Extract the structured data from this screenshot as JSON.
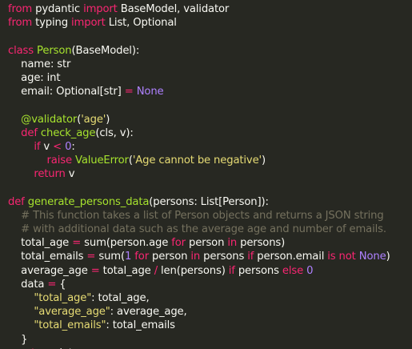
{
  "editor": {
    "lines": [
      [
        [
          "kw",
          "from"
        ],
        [
          "pl",
          " pydantic "
        ],
        [
          "kw",
          "import"
        ],
        [
          "pl",
          " BaseModel, validator"
        ]
      ],
      [
        [
          "kw",
          "from"
        ],
        [
          "pl",
          " typing "
        ],
        [
          "kw",
          "import"
        ],
        [
          "pl",
          " List, Optional"
        ]
      ],
      [],
      [
        [
          "kw",
          "class"
        ],
        [
          "pl",
          " "
        ],
        [
          "cls",
          "Person"
        ],
        [
          "pl",
          "(BaseModel):"
        ]
      ],
      [
        [
          "pl",
          "    name: str"
        ]
      ],
      [
        [
          "pl",
          "    age: int"
        ]
      ],
      [
        [
          "pl",
          "    email: Optional[str] "
        ],
        [
          "op",
          "="
        ],
        [
          "pl",
          " "
        ],
        [
          "con",
          "None"
        ]
      ],
      [],
      [
        [
          "pl",
          "    "
        ],
        [
          "dec",
          "@validator"
        ],
        [
          "pl",
          "("
        ],
        [
          "str",
          "'age'"
        ],
        [
          "pl",
          ")"
        ]
      ],
      [
        [
          "pl",
          "    "
        ],
        [
          "kw",
          "def"
        ],
        [
          "pl",
          " "
        ],
        [
          "fn",
          "check_age"
        ],
        [
          "pl",
          "(cls, v):"
        ]
      ],
      [
        [
          "pl",
          "        "
        ],
        [
          "kw",
          "if"
        ],
        [
          "pl",
          " v "
        ],
        [
          "op",
          "<"
        ],
        [
          "pl",
          " "
        ],
        [
          "num",
          "0"
        ],
        [
          "pl",
          ":"
        ]
      ],
      [
        [
          "pl",
          "            "
        ],
        [
          "kw",
          "raise"
        ],
        [
          "pl",
          " "
        ],
        [
          "fn",
          "ValueError"
        ],
        [
          "pl",
          "("
        ],
        [
          "str",
          "'Age cannot be negative'"
        ],
        [
          "pl",
          ")"
        ]
      ],
      [
        [
          "pl",
          "        "
        ],
        [
          "kw",
          "return"
        ],
        [
          "pl",
          " v"
        ]
      ],
      [],
      [
        [
          "kw",
          "def"
        ],
        [
          "pl",
          " "
        ],
        [
          "fn",
          "generate_persons_data"
        ],
        [
          "pl",
          "(persons: List[Person]):"
        ]
      ],
      [
        [
          "pl",
          "    "
        ],
        [
          "cmt",
          "# This function takes a list of Person objects and returns a JSON string"
        ]
      ],
      [
        [
          "pl",
          "    "
        ],
        [
          "cmt",
          "# with additional data such as the average age and number of emails."
        ]
      ],
      [
        [
          "pl",
          "    total_age "
        ],
        [
          "op",
          "="
        ],
        [
          "pl",
          " sum(person.age "
        ],
        [
          "kw",
          "for"
        ],
        [
          "pl",
          " person "
        ],
        [
          "kw",
          "in"
        ],
        [
          "pl",
          " persons)"
        ]
      ],
      [
        [
          "pl",
          "    total_emails "
        ],
        [
          "op",
          "="
        ],
        [
          "pl",
          " sum("
        ],
        [
          "num",
          "1"
        ],
        [
          "pl",
          " "
        ],
        [
          "kw",
          "for"
        ],
        [
          "pl",
          " person "
        ],
        [
          "kw",
          "in"
        ],
        [
          "pl",
          " persons "
        ],
        [
          "kw",
          "if"
        ],
        [
          "pl",
          " person.email "
        ],
        [
          "kw",
          "is not"
        ],
        [
          "pl",
          " "
        ],
        [
          "con",
          "None"
        ],
        [
          "pl",
          ")"
        ]
      ],
      [
        [
          "pl",
          "    average_age "
        ],
        [
          "op",
          "="
        ],
        [
          "pl",
          " total_age "
        ],
        [
          "op",
          "/"
        ],
        [
          "pl",
          " len(persons) "
        ],
        [
          "kw",
          "if"
        ],
        [
          "pl",
          " persons "
        ],
        [
          "kw",
          "else"
        ],
        [
          "pl",
          " "
        ],
        [
          "num",
          "0"
        ]
      ],
      [
        [
          "pl",
          "    data "
        ],
        [
          "op",
          "="
        ],
        [
          "pl",
          " {"
        ]
      ],
      [
        [
          "pl",
          "        "
        ],
        [
          "str",
          "\"total_age\""
        ],
        [
          "pl",
          ": total_age,"
        ]
      ],
      [
        [
          "pl",
          "        "
        ],
        [
          "str",
          "\"average_age\""
        ],
        [
          "pl",
          ": average_age,"
        ]
      ],
      [
        [
          "pl",
          "        "
        ],
        [
          "str",
          "\"total_emails\""
        ],
        [
          "pl",
          ": total_emails"
        ]
      ],
      [
        [
          "pl",
          "    }"
        ]
      ],
      [
        [
          "pl",
          "    "
        ],
        [
          "kw",
          "return"
        ],
        [
          "pl",
          " data"
        ]
      ]
    ]
  }
}
